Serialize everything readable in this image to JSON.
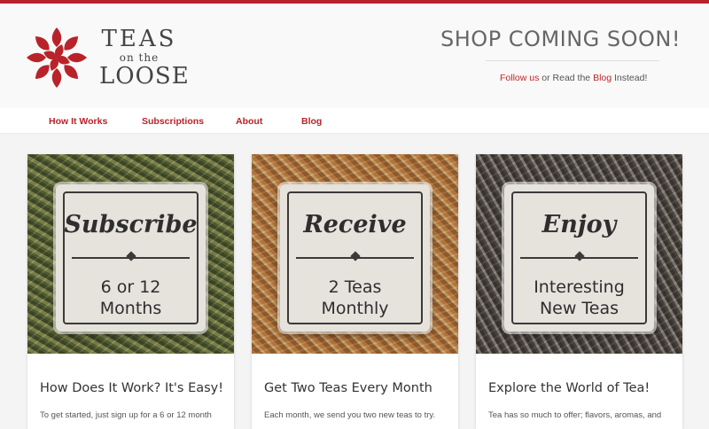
{
  "brand": {
    "line1": "TEAS",
    "line2": "on the",
    "line3": "LOOSE",
    "accent_color": "#b8232a"
  },
  "header": {
    "headline": "SHOP COMING SOON!",
    "follow_link": "Follow us",
    "follow_middle": " or Read the ",
    "blog_link": "Blog",
    "follow_end": " Instead!"
  },
  "nav": {
    "items": [
      {
        "label": "How It Works"
      },
      {
        "label": "Subscriptions"
      },
      {
        "label": "About"
      },
      {
        "label": "Blog"
      }
    ]
  },
  "cards": [
    {
      "plaque_script": "Subscribe",
      "plaque_line1": "6 or 12",
      "plaque_line2": "Months",
      "title": "How Does It Work? It's Easy!",
      "text": "To get started, just sign up for a 6 or 12 month"
    },
    {
      "plaque_script": "Receive",
      "plaque_line1": "2 Teas",
      "plaque_line2": "Monthly",
      "title": "Get Two Teas Every Month",
      "text": "Each month, we send you two new teas to try."
    },
    {
      "plaque_script": "Enjoy",
      "plaque_line1": "Interesting",
      "plaque_line2": "New Teas",
      "title": "Explore the World of Tea!",
      "text": "Tea has so much to offer; flavors, aromas, and"
    }
  ],
  "icons": {
    "logo": "tea-leaf-flower-logo-icon"
  }
}
